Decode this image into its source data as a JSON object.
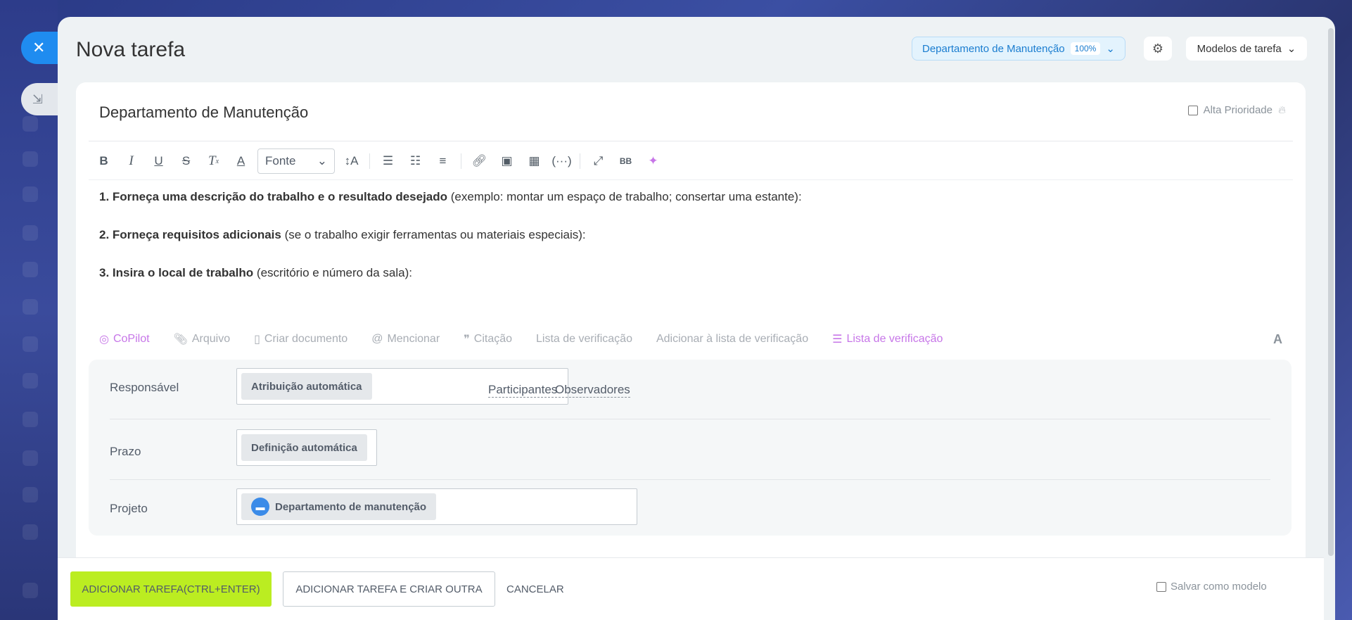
{
  "header": {
    "title": "Nova tarefa",
    "department": "Departamento de Manutenção",
    "department_pct": "100%",
    "templates_label": "Modelos de tarefa"
  },
  "task": {
    "title": "Departamento de Manutenção",
    "priority_label": "Alta Prioridade"
  },
  "toolbar": {
    "font_label": "Fonte"
  },
  "description": [
    {
      "bold": "1. Forneça uma descrição do trabalho e o resultado desejado",
      "rest": " (exemplo: montar um espaço de trabalho; consertar uma estante):"
    },
    {
      "bold": "2. Forneça requisitos adicionais",
      "rest": " (se o trabalho exigir ferramentas ou materiais especiais):"
    },
    {
      "bold": "3. Insira o local de trabalho",
      "rest": " (escritório e número da sala):"
    }
  ],
  "attach_bar": {
    "copilot": "CoPilot",
    "file": "Arquivo",
    "create_doc": "Criar documento",
    "mention": "Mencionar",
    "quote": "Citação",
    "checklist": "Lista de verificação",
    "add_checklist": "Adicionar à lista de verificação",
    "checklist2": "Lista de verificação",
    "format": "A"
  },
  "fields": {
    "responsible_label": "Responsável",
    "responsible_value": "Atribuição automática",
    "participants": "Participantes",
    "observers": "Observadores",
    "deadline_label": "Prazo",
    "deadline_value": "Definição automática",
    "project_label": "Projeto",
    "project_value": "Departamento de manutenção"
  },
  "footer": {
    "add_task": "ADICIONAR TAREFA(CTRL+ENTER)",
    "add_and_create": "ADICIONAR TAREFA E CRIAR OUTRA",
    "cancel": "CANCELAR",
    "save_template": "Salvar como modelo"
  },
  "colors": {
    "accent": "#1f8cf0",
    "primary_button": "#bbed21",
    "copilot": "#c776e8"
  }
}
